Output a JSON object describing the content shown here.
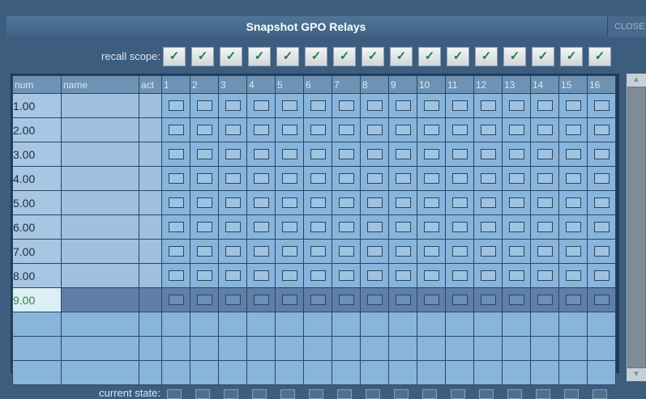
{
  "window": {
    "title": "Snapshot GPO Relays",
    "close_label": "CLOSE"
  },
  "recall_scope": {
    "label": "recall scope:",
    "check_glyph": "✓",
    "states": [
      true,
      true,
      true,
      true,
      true,
      true,
      true,
      true,
      true,
      true,
      true,
      true,
      true,
      true,
      true,
      true
    ]
  },
  "columns": {
    "num": "num",
    "name": "name",
    "act": "act",
    "relays": [
      "1",
      "2",
      "3",
      "4",
      "5",
      "6",
      "7",
      "8",
      "9",
      "10",
      "11",
      "12",
      "13",
      "14",
      "15",
      "16"
    ]
  },
  "rows": [
    {
      "num": "1.00",
      "name": ""
    },
    {
      "num": "2.00",
      "name": ""
    },
    {
      "num": "3.00",
      "name": ""
    },
    {
      "num": "4.00",
      "name": ""
    },
    {
      "num": "5.00",
      "name": ""
    },
    {
      "num": "6.00",
      "name": ""
    },
    {
      "num": "7.00",
      "name": ""
    },
    {
      "num": "8.00",
      "name": ""
    },
    {
      "num": "9.00",
      "name": "",
      "selected": true
    }
  ],
  "empty_rows": 3,
  "current_state": {
    "label": "current state:"
  },
  "colors": {
    "accent_check": "#2c7a3a",
    "selected_row": "#5f7fa8",
    "cell": "#89b4dc"
  }
}
